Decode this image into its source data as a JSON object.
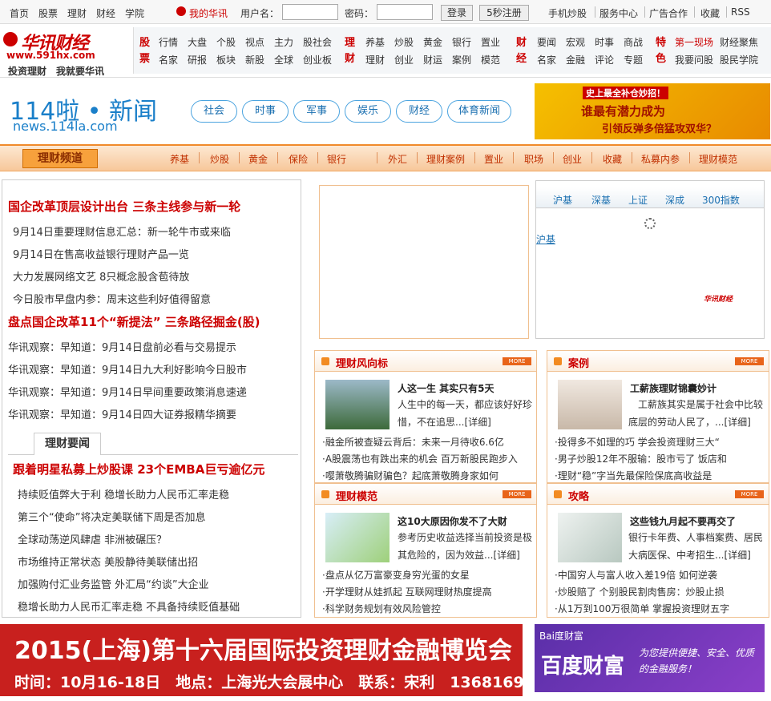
{
  "topbar": {
    "links": [
      "首页",
      "股票",
      "理财",
      "财经",
      "学院"
    ],
    "my_label": "我的华讯",
    "username_label": "用户名：",
    "password_label": "密码：",
    "login_btn": "登录",
    "register_btn": "5秒注册",
    "right_links": [
      "手机炒股",
      "服务中心",
      "广告合作",
      "收藏",
      "RSS"
    ]
  },
  "logo": {
    "main": "华讯财经",
    "url": "www.591hx.com",
    "slogan": "投资理财　我就要华讯"
  },
  "nav": {
    "groups": [
      {
        "cat": "股票",
        "row1": [
          "行情",
          "大盘",
          "个股",
          "视点",
          "主力",
          "股社会"
        ],
        "row2": [
          "名家",
          "研报",
          "板块",
          "新股",
          "全球",
          "创业板"
        ]
      },
      {
        "cat": "理财",
        "row1": [
          "养基",
          "炒股",
          "黄金",
          "银行",
          "置业"
        ],
        "row2": [
          "理财",
          "创业",
          "财运",
          "案例",
          "模范"
        ]
      },
      {
        "cat": "财经",
        "row1": [
          "要闻",
          "宏观",
          "时事",
          "商战"
        ],
        "row2": [
          "名家",
          "金融",
          "评论",
          "专题"
        ]
      },
      {
        "cat": "特色",
        "row1": [
          "第一现场",
          "财经聚焦"
        ],
        "row2": [
          "我要问股",
          "股民学院"
        ]
      }
    ]
  },
  "banner": {
    "brand": "114啦 • 新闻",
    "brand_sub": "news.114la.com",
    "pills": [
      "社会",
      "时事",
      "军事",
      "娱乐",
      "财经",
      "体育新闻"
    ],
    "ad_line1": "史上最全补仓妙招！",
    "ad_line2": "谁最有潜力成为",
    "ad_line3": "引领反弹多倍猛攻双华？"
  },
  "channel": {
    "title": "理财频道",
    "items": [
      "养基",
      "炒股",
      "黄金",
      "保险",
      "银行",
      "外汇",
      "理财案例",
      "置业",
      "职场",
      "创业",
      "收藏",
      "私募内参",
      "理财模范"
    ]
  },
  "left": {
    "headline1": "国企改革顶层设计出台 三条主线参与新一轮",
    "list1": [
      "9月14日重要理财信息汇总：新一轮牛市或来临",
      "9月14日在售高收益银行理财产品一览",
      "大力发展网络文艺 8只概念股含苞待放",
      "今日股市早盘内参：周末这些利好值得留意"
    ],
    "headline2": "盘点国企改革11个“新提法” 三条路径掘金(股)",
    "list2": [
      "华讯观察：早知道：9月14日盘前必看与交易提示",
      "华讯观察：早知道：9月14日九大利好影响今日股市",
      "华讯观察：早知道：9月14日早间重要政策消息速递",
      "华讯观察：早知道：9月14日四大证券报精华摘要"
    ],
    "tab": "理财要闻",
    "headline3": "跟着明星私募上炒股课 23个EMBA巨亏逾亿元",
    "list3": [
      "持续贬值弊大于利 稳增长助力人民币汇率走稳",
      "第三个“使命”将决定美联储下周是否加息",
      "全球动荡逆风肆虐 非洲被碾压？",
      "市场维持正常状态 美股静待美联储出招",
      "加强购付汇业务监管 外汇局“约谈”大企业",
      "稳增长助力人民币汇率走稳 不具备持续贬值基础"
    ]
  },
  "market": {
    "tabs": [
      "沪基",
      "深基",
      "上证",
      "深成",
      "300指数"
    ],
    "link": "沪基",
    "watermark": "华讯财经"
  },
  "sections": [
    {
      "title": "理财风向标",
      "more": "MORE",
      "art_title": "人这一生 其实只有5天",
      "art_desc": "人生中的每一天，都应该好好珍惜，不在追思...[详细]",
      "bullets": [
        "·融金所被查疑云背后：未来一月待收6.6亿",
        "·A股震荡也有跌出来的机会 百万新股民跑步入",
        "·嘤萧敬腾骗财骗色？起底萧敬腾身家如何"
      ]
    },
    {
      "title": "案例",
      "more": "MORE",
      "art_title": "工薪族理财锦囊妙计",
      "art_desc": "　工薪族其实是属于社会中比较底层的劳动人民了，...[详细]",
      "bullets": [
        "·投得多不如理的巧 学会投资理财三大“",
        "·男子炒股12年不服输：股市亏了 饭店和",
        "·理财“稳”字当先最保险保底高收益是"
      ]
    },
    {
      "title": "理财模范",
      "more": "MORE",
      "art_title": "这10大原因你发不了大财",
      "art_desc": "参考历史收益选择当前投资是极其危险的，因为效益...[详细]",
      "bullets": [
        "·盘点从亿万富豪变身穷光蛋的女星",
        "·开学理财从娃抓起 互联网理财热度提高",
        "·科学财务规划有效风险管控"
      ]
    },
    {
      "title": "攻略",
      "more": "MORE",
      "art_title": "这些钱九月起不要再交了",
      "art_desc": "银行卡年费、人事档案费、居民大病医保、中考招生...[详细]",
      "bullets": [
        "·中国穷人与富人收入差19倍 如何逆袭",
        "·炒股赔了 个别股民割肉售房：炒股止损",
        "·从1万到100万很简单 掌握投资理财五字"
      ]
    }
  ],
  "bottom_ads": {
    "ad1_line1": "2015(上海)第十六届国际投资理财金融博览会",
    "ad1_line2": "时间：10月16-18日　地点：上海光大会展中心　联系：宋利　13681692751",
    "ad2_brand": "Bai度财富",
    "ad2_title": "百度财富",
    "ad2_slogan": "为您提供便捷、安全、优质的金融服务！"
  }
}
